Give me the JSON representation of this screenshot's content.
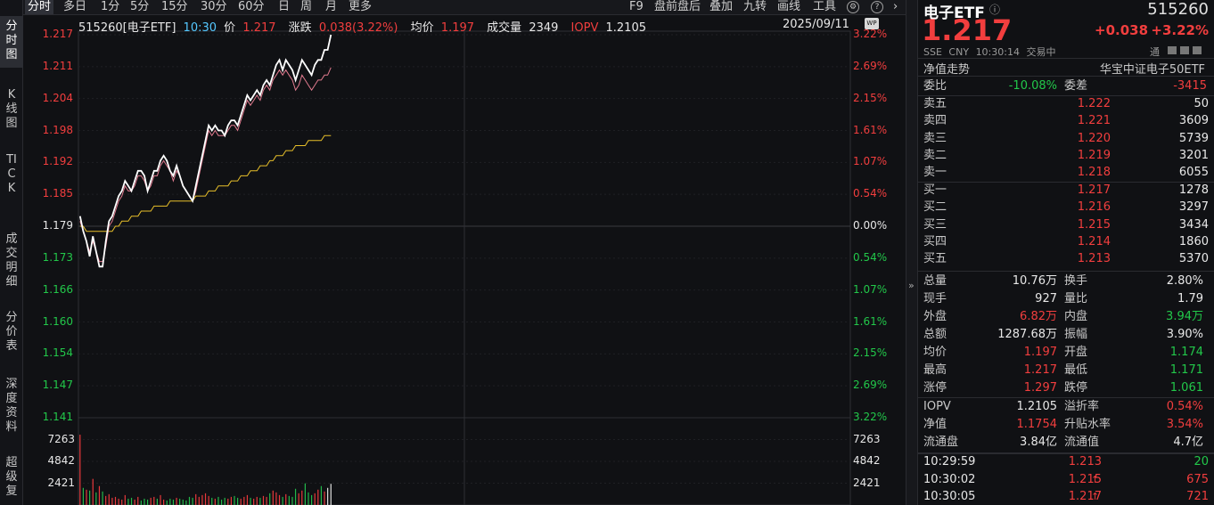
{
  "left_tabs": [
    "分时图",
    "K线图",
    "TICK",
    "成交明细",
    "分价表",
    "深度资料",
    "超级复"
  ],
  "toolbar": {
    "periods": [
      "分时",
      "多日",
      "1分",
      "5分",
      "15分",
      "30分",
      "60分",
      "日",
      "周",
      "月",
      "更多"
    ],
    "actions": [
      "F9",
      "盘前盘后",
      "叠加",
      "九转",
      "画线",
      "工具"
    ],
    "icon_settings": "⚙",
    "icon_help": "?",
    "icon_next": "›"
  },
  "chart_header": {
    "code_name": "515260[电子ETF]",
    "time": "10:30",
    "price_label": "价",
    "price": "1.217",
    "change_label": "涨跌",
    "change": "0.038(3.22%)",
    "avg_label": "均价",
    "avg": "1.197",
    "volume_label": "成交量",
    "volume": "2349",
    "iopv_label": "IOPV",
    "iopv": "1.2105",
    "date": "2025/09/11",
    "badge": "WP"
  },
  "chart_data": {
    "type": "line",
    "price_axis": {
      "ticks": [
        "1.217",
        "1.211",
        "1.204",
        "1.198",
        "1.192",
        "1.185",
        "1.179",
        "1.173",
        "1.166",
        "1.160",
        "1.154",
        "1.147",
        "1.141"
      ],
      "pct_ticks": [
        "3.22%",
        "2.69%",
        "2.15%",
        "1.61%",
        "1.07%",
        "0.54%",
        "0.00%",
        "0.54%",
        "1.07%",
        "1.61%",
        "2.15%",
        "2.69%",
        "3.22%"
      ],
      "ylim": [
        1.141,
        1.217
      ],
      "prev_close": 1.179
    },
    "volume_axis": {
      "ticks": [
        "7263",
        "4842",
        "2421"
      ],
      "ylim": [
        0,
        9684
      ]
    },
    "minutes_total": 240,
    "series": [
      {
        "key": "price",
        "values": [
          1.181,
          1.178,
          1.176,
          1.173,
          1.177,
          1.174,
          1.171,
          1.171,
          1.176,
          1.18,
          1.181,
          1.183,
          1.185,
          1.186,
          1.188,
          1.187,
          1.186,
          1.188,
          1.19,
          1.19,
          1.189,
          1.186,
          1.188,
          1.19,
          1.19,
          1.192,
          1.193,
          1.192,
          1.19,
          1.189,
          1.191,
          1.189,
          1.187,
          1.186,
          1.185,
          1.184,
          1.187,
          1.19,
          1.193,
          1.196,
          1.199,
          1.198,
          1.199,
          1.198,
          1.198,
          1.197,
          1.199,
          1.2,
          1.2,
          1.199,
          1.201,
          1.203,
          1.205,
          1.204,
          1.205,
          1.206,
          1.205,
          1.207,
          1.208,
          1.207,
          1.209,
          1.211,
          1.212,
          1.21,
          1.212,
          1.211,
          1.21,
          1.208,
          1.21,
          1.212,
          1.211,
          1.21,
          1.209,
          1.211,
          1.212,
          1.212,
          1.214,
          1.214,
          1.217
        ]
      },
      {
        "key": "iopv",
        "values": [
          1.18,
          1.178,
          1.176,
          1.174,
          1.176,
          1.174,
          1.172,
          1.172,
          1.175,
          1.179,
          1.18,
          1.182,
          1.184,
          1.185,
          1.187,
          1.186,
          1.186,
          1.187,
          1.189,
          1.189,
          1.188,
          1.186,
          1.187,
          1.189,
          1.189,
          1.191,
          1.192,
          1.191,
          1.19,
          1.188,
          1.19,
          1.189,
          1.187,
          1.186,
          1.185,
          1.184,
          1.186,
          1.189,
          1.192,
          1.195,
          1.198,
          1.197,
          1.198,
          1.197,
          1.197,
          1.197,
          1.198,
          1.199,
          1.199,
          1.198,
          1.2,
          1.202,
          1.204,
          1.203,
          1.204,
          1.205,
          1.204,
          1.206,
          1.207,
          1.206,
          1.208,
          1.209,
          1.21,
          1.209,
          1.21,
          1.209,
          1.208,
          1.206,
          1.207,
          1.209,
          1.208,
          1.207,
          1.206,
          1.207,
          1.208,
          1.208,
          1.209,
          1.209,
          1.2105
        ]
      },
      {
        "key": "average",
        "values": [
          1.179,
          1.179,
          1.178,
          1.178,
          1.178,
          1.178,
          1.178,
          1.178,
          1.178,
          1.178,
          1.178,
          1.179,
          1.179,
          1.18,
          1.18,
          1.18,
          1.181,
          1.181,
          1.181,
          1.182,
          1.182,
          1.182,
          1.182,
          1.183,
          1.183,
          1.183,
          1.183,
          1.183,
          1.184,
          1.184,
          1.184,
          1.184,
          1.184,
          1.184,
          1.184,
          1.184,
          1.185,
          1.185,
          1.185,
          1.185,
          1.186,
          1.186,
          1.186,
          1.187,
          1.187,
          1.187,
          1.187,
          1.188,
          1.188,
          1.188,
          1.189,
          1.189,
          1.189,
          1.19,
          1.19,
          1.19,
          1.191,
          1.191,
          1.191,
          1.192,
          1.192,
          1.193,
          1.193,
          1.193,
          1.194,
          1.194,
          1.194,
          1.195,
          1.195,
          1.195,
          1.195,
          1.196,
          1.196,
          1.196,
          1.196,
          1.196,
          1.197,
          1.197,
          1.197
        ]
      }
    ],
    "volume": [
      7800,
      1900,
      1700,
      1600,
      2900,
      1400,
      2100,
      1500,
      1000,
      1200,
      800,
      900,
      700,
      600,
      1100,
      700,
      800,
      600,
      900,
      500,
      700,
      600,
      800,
      900,
      700,
      1100,
      600,
      500,
      700,
      600,
      800,
      700,
      600,
      500,
      900,
      800,
      1200,
      900,
      1100,
      1300,
      1000,
      800,
      700,
      900,
      600,
      800,
      700,
      900,
      1000,
      800,
      700,
      900,
      1100,
      800,
      700,
      900,
      800,
      1000,
      900,
      1300,
      1600,
      1400,
      1100,
      900,
      1200,
      1000,
      900,
      1800,
      1300,
      1600,
      2400,
      1400,
      1100,
      1300,
      1700,
      2100,
      1500,
      1900,
      2349
    ],
    "volume_color": [
      "red",
      "green",
      "red",
      "green",
      "red",
      "green",
      "red",
      "green",
      "red",
      "red",
      "red",
      "red",
      "red",
      "red",
      "red",
      "green",
      "green",
      "red",
      "red",
      "green",
      "green",
      "green",
      "red",
      "red",
      "green",
      "red",
      "red",
      "green",
      "green",
      "green",
      "red",
      "green",
      "green",
      "green",
      "green",
      "green",
      "red",
      "red",
      "red",
      "red",
      "red",
      "green",
      "red",
      "green",
      "green",
      "green",
      "red",
      "red",
      "green",
      "green",
      "red",
      "red",
      "red",
      "green",
      "red",
      "red",
      "green",
      "red",
      "red",
      "green",
      "red",
      "red",
      "red",
      "green",
      "red",
      "green",
      "green",
      "green",
      "red",
      "red",
      "green",
      "green",
      "green",
      "red",
      "red",
      "green",
      "red",
      "white",
      "white"
    ]
  },
  "quote": {
    "name": "电子ETF",
    "info_icon": "ⓘ",
    "code": "515260",
    "price": "1.217",
    "change": "+0.038",
    "change_pct": "+3.22%",
    "exchange": "SSE",
    "currency": "CNY",
    "time": "10:30:14",
    "status": "交易中",
    "tong": "通",
    "nav_trend": "净值走势",
    "index_name": "华宝中证电子50ETF"
  },
  "weibi": {
    "label1": "委比",
    "value1": "-10.08%",
    "label2": "委差",
    "value2": "-3415"
  },
  "sells": [
    {
      "label": "卖五",
      "price": "1.222",
      "vol": "50"
    },
    {
      "label": "卖四",
      "price": "1.221",
      "vol": "3609"
    },
    {
      "label": "卖三",
      "price": "1.220",
      "vol": "5739"
    },
    {
      "label": "卖二",
      "price": "1.219",
      "vol": "3201"
    },
    {
      "label": "卖一",
      "price": "1.218",
      "vol": "6055"
    }
  ],
  "buys": [
    {
      "label": "买一",
      "price": "1.217",
      "vol": "1278"
    },
    {
      "label": "买二",
      "price": "1.216",
      "vol": "3297"
    },
    {
      "label": "买三",
      "price": "1.215",
      "vol": "3434"
    },
    {
      "label": "买四",
      "price": "1.214",
      "vol": "1860"
    },
    {
      "label": "买五",
      "price": "1.213",
      "vol": "5370"
    }
  ],
  "stats": [
    [
      {
        "label": "总量",
        "value": "10.76万",
        "color": "white"
      },
      {
        "label": "换手",
        "value": "2.80%",
        "color": "white"
      }
    ],
    [
      {
        "label": "现手",
        "value": "927",
        "color": "white"
      },
      {
        "label": "量比",
        "value": "1.79",
        "color": "white"
      }
    ],
    [
      {
        "label": "外盘",
        "value": "6.82万",
        "color": "red"
      },
      {
        "label": "内盘",
        "value": "3.94万",
        "color": "green"
      }
    ],
    [
      {
        "label": "总额",
        "value": "1287.68万",
        "color": "white"
      },
      {
        "label": "振幅",
        "value": "3.90%",
        "color": "white"
      }
    ],
    [
      {
        "label": "均价",
        "value": "1.197",
        "color": "red"
      },
      {
        "label": "开盘",
        "value": "1.174",
        "color": "green"
      }
    ],
    [
      {
        "label": "最高",
        "value": "1.217",
        "color": "red"
      },
      {
        "label": "最低",
        "value": "1.171",
        "color": "green"
      }
    ],
    [
      {
        "label": "涨停",
        "value": "1.297",
        "color": "red"
      },
      {
        "label": "跌停",
        "value": "1.061",
        "color": "green"
      }
    ]
  ],
  "stats2": [
    [
      {
        "label": "IOPV",
        "value": "1.2105",
        "color": "white"
      },
      {
        "label": "溢折率",
        "value": "0.54%",
        "color": "red"
      }
    ],
    [
      {
        "label": "净值",
        "value": "1.1754",
        "color": "red"
      },
      {
        "label": "升贴水率",
        "value": "3.54%",
        "color": "red"
      }
    ],
    [
      {
        "label": "流通盘",
        "value": "3.84亿",
        "color": "white"
      },
      {
        "label": "流通值",
        "value": "4.7亿",
        "color": "white"
      }
    ]
  ],
  "ticks": [
    {
      "time": "10:29:59",
      "price": "1.213",
      "arrow": "",
      "vol": "20",
      "vol_color": "green"
    },
    {
      "time": "10:30:02",
      "price": "1.215",
      "arrow": "↑",
      "vol": "675",
      "vol_color": "red"
    },
    {
      "time": "10:30:05",
      "price": "1.217",
      "arrow": "↑",
      "vol": "721",
      "vol_color": "red"
    }
  ],
  "divider_arrow": "»"
}
